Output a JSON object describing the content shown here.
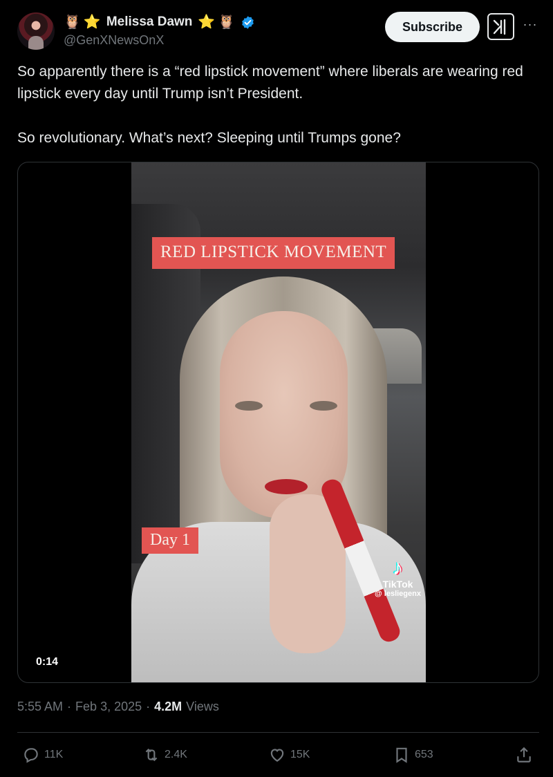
{
  "author": {
    "prefix_emoji": [
      "🦉",
      "⭐"
    ],
    "display_name": "Melissa Dawn",
    "suffix_emoji": [
      "⭐",
      "🦉"
    ],
    "handle": "@GenXNewsOnX",
    "verified": true
  },
  "header": {
    "subscribe_label": "Subscribe",
    "more_label": "···"
  },
  "tweet": {
    "paragraphs": [
      "So apparently there is a “red lipstick movement” where liberals are wearing red lipstick every day until Trump isn’t President.",
      "So revolutionary. What’s next? Sleeping until Trumps gone?"
    ]
  },
  "media": {
    "overlay_title": "RED LIPSTICK MOVEMENT",
    "overlay_day": "Day 1",
    "tiktok_name": "TikTok",
    "tiktok_user": "@ lesliegenx",
    "duration": "0:14"
  },
  "meta": {
    "time": "5:55 AM",
    "separator": "·",
    "date": "Feb 3, 2025",
    "views_count": "4.2M",
    "views_label": "Views"
  },
  "actions": {
    "replies": "11K",
    "reposts": "2.4K",
    "likes": "15K",
    "bookmarks": "653"
  },
  "colors": {
    "background": "#000000",
    "text": "#e7e9ea",
    "secondary_text": "#71767b",
    "verified_blue": "#1d9bf0",
    "overlay_red": "#e25552"
  }
}
